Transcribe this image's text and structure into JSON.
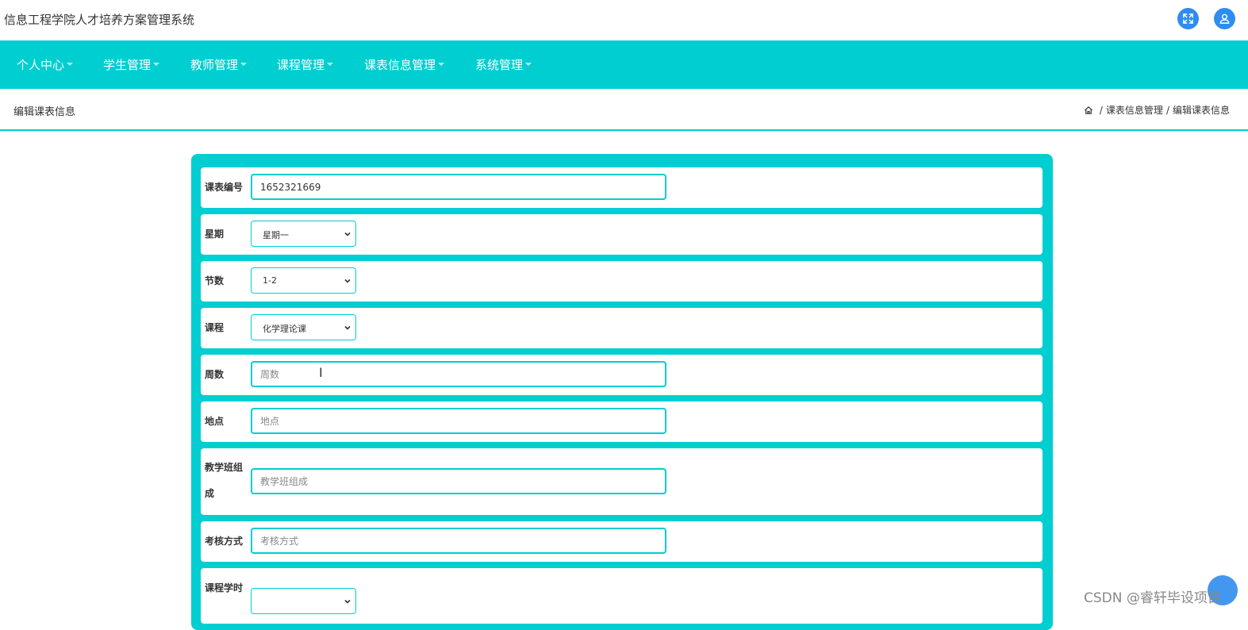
{
  "header": {
    "app_title": "信息工程学院人才培养方案管理系统",
    "fullscreen_icon": "expand-icon",
    "user_icon": "user-icon",
    "accent_color": "#2f8cf0"
  },
  "nav": {
    "background": "#00ced1",
    "items": [
      {
        "label": "个人中心"
      },
      {
        "label": "学生管理"
      },
      {
        "label": "教师管理"
      },
      {
        "label": "课程管理"
      },
      {
        "label": "课表信息管理"
      },
      {
        "label": "系统管理"
      }
    ]
  },
  "page": {
    "title": "编辑课表信息",
    "breadcrumb": {
      "home_icon": "home-icon",
      "items": [
        "课表信息管理",
        "编辑课表信息"
      ],
      "separator": "/"
    }
  },
  "form": {
    "fields": [
      {
        "label": "课表编号",
        "type": "text",
        "value": "1652321669",
        "placeholder": ""
      },
      {
        "label": "星期",
        "type": "select",
        "value": "星期一"
      },
      {
        "label": "节数",
        "type": "select",
        "value": "1-2"
      },
      {
        "label": "课程",
        "type": "select",
        "value": "化学理论课"
      },
      {
        "label": "周数",
        "type": "text",
        "value": "",
        "placeholder": "周数"
      },
      {
        "label": "地点",
        "type": "text",
        "value": "",
        "placeholder": "地点"
      },
      {
        "label": "教学班组成",
        "type": "text",
        "value": "",
        "placeholder": "教学班组成"
      },
      {
        "label": "考核方式",
        "type": "text",
        "value": "",
        "placeholder": "考核方式"
      },
      {
        "label": "课程学时",
        "type": "select",
        "value": ""
      }
    ]
  },
  "watermark": "CSDN @睿轩毕设项目"
}
